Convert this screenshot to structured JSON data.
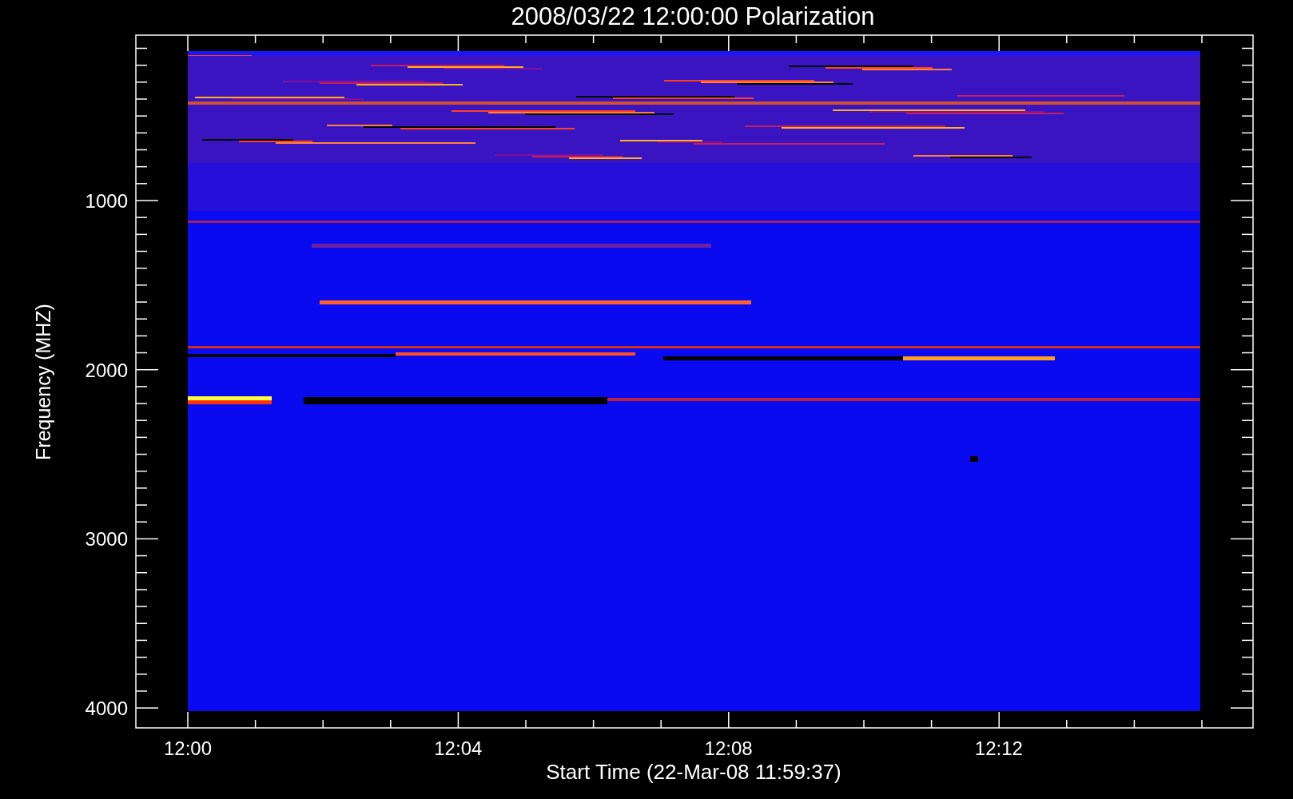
{
  "title": "2008/03/22 12:00:00 Polarization",
  "y_axis": {
    "label": "Frequency (MHZ)",
    "ticks": [
      "1000",
      "2000",
      "3000",
      "4000"
    ]
  },
  "x_axis": {
    "label": "Start Time (22-Mar-08 11:59:37)",
    "ticks": [
      "12:00",
      "12:04",
      "12:08",
      "12:12"
    ]
  }
}
